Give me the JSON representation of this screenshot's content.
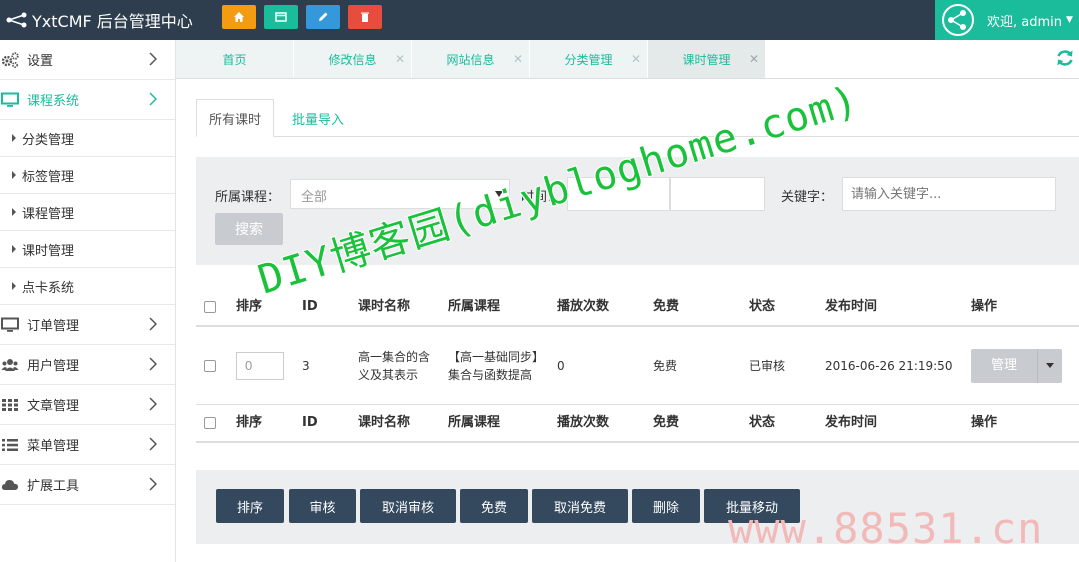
{
  "header": {
    "brand": "YxtCMF 后台管理中心",
    "quick_buttons": [
      {
        "name": "home-icon",
        "color": "#f39c12"
      },
      {
        "name": "window-icon",
        "color": "#1abc9c"
      },
      {
        "name": "pencil-icon",
        "color": "#3498db"
      },
      {
        "name": "trash-icon",
        "color": "#e74c3c"
      }
    ],
    "welcome": "欢迎, admin"
  },
  "sidebar": {
    "items": [
      {
        "label": "设置",
        "icon": "gears-icon"
      },
      {
        "label": "课程系统",
        "icon": "monitor-icon",
        "active": true
      },
      {
        "label": "订单管理",
        "icon": "monitor-icon"
      },
      {
        "label": "用户管理",
        "icon": "users-icon"
      },
      {
        "label": "文章管理",
        "icon": "grid-icon"
      },
      {
        "label": "菜单管理",
        "icon": "list-icon"
      },
      {
        "label": "扩展工具",
        "icon": "cloud-icon"
      }
    ],
    "subitems": [
      "分类管理",
      "标签管理",
      "课程管理",
      "课时管理",
      "点卡系统"
    ]
  },
  "tabs": [
    {
      "label": "首页"
    },
    {
      "label": "修改信息"
    },
    {
      "label": "网站信息"
    },
    {
      "label": "分类管理"
    },
    {
      "label": "课时管理",
      "active": true
    }
  ],
  "subtabs": [
    "所有课时",
    "批量导入"
  ],
  "filter": {
    "course_label": "所属课程：",
    "course_value": "全部",
    "time_label": "时间：",
    "keyword_label": "关键字：",
    "keyword_placeholder": "请输入关键字...",
    "search_button": "搜索"
  },
  "table": {
    "headers": [
      "排序",
      "ID",
      "课时名称",
      "所属课程",
      "播放次数",
      "免费",
      "状态",
      "发布时间",
      "操作"
    ],
    "rows": [
      {
        "order": "0",
        "id": "3",
        "name": "高一集合的含义及其表示",
        "course": "【高一基础同步】集合与函数提高",
        "plays": "0",
        "free": "免费",
        "status": "已审核",
        "time": "2016-06-26 21:19:50",
        "action": "管理"
      }
    ]
  },
  "actions": [
    "排序",
    "审核",
    "取消审核",
    "免费",
    "取消免费",
    "删除",
    "批量移动"
  ],
  "watermarks": {
    "main": "DIY博客园(diybloghome.com)",
    "corner": "www.88531.cn"
  }
}
